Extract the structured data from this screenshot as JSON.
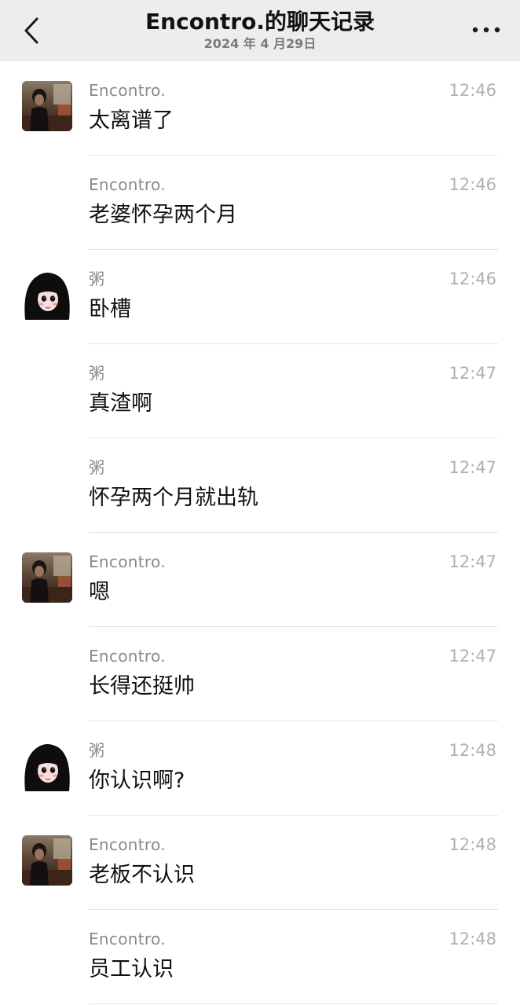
{
  "header": {
    "title": "Encontro.的聊天记录",
    "date": "2024 年 4 月29日"
  },
  "messages": [
    {
      "sender": "Encontro.",
      "time": "12:46",
      "text": "太离谱了",
      "avatar": "photo"
    },
    {
      "sender": "Encontro.",
      "time": "12:46",
      "text": "老婆怀孕两个月",
      "avatar": null
    },
    {
      "sender": "粥",
      "time": "12:46",
      "text": "卧槽",
      "avatar": "anime"
    },
    {
      "sender": "粥",
      "time": "12:47",
      "text": "真渣啊",
      "avatar": null
    },
    {
      "sender": "粥",
      "time": "12:47",
      "text": "怀孕两个月就出轨",
      "avatar": null
    },
    {
      "sender": "Encontro.",
      "time": "12:47",
      "text": "嗯",
      "avatar": "photo"
    },
    {
      "sender": "Encontro.",
      "time": "12:47",
      "text": "长得还挺帅",
      "avatar": null
    },
    {
      "sender": "粥",
      "time": "12:48",
      "text": "你认识啊?",
      "avatar": "anime"
    },
    {
      "sender": "Encontro.",
      "time": "12:48",
      "text": "老板不认识",
      "avatar": "photo"
    },
    {
      "sender": "Encontro.",
      "time": "12:48",
      "text": "员工认识",
      "avatar": null
    }
  ]
}
